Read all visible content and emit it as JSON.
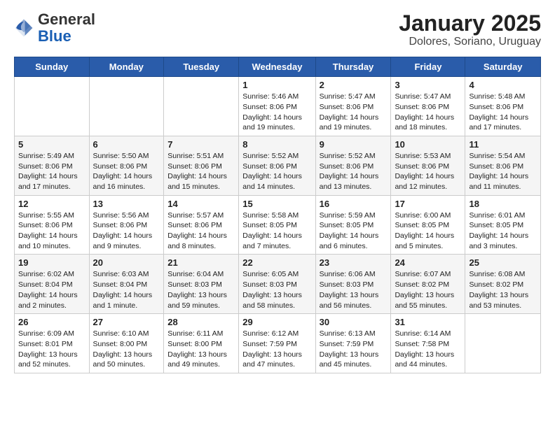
{
  "header": {
    "logo_general": "General",
    "logo_blue": "Blue",
    "title": "January 2025",
    "subtitle": "Dolores, Soriano, Uruguay"
  },
  "weekdays": [
    "Sunday",
    "Monday",
    "Tuesday",
    "Wednesday",
    "Thursday",
    "Friday",
    "Saturday"
  ],
  "weeks": [
    [
      {
        "day": "",
        "info": ""
      },
      {
        "day": "",
        "info": ""
      },
      {
        "day": "",
        "info": ""
      },
      {
        "day": "1",
        "info": "Sunrise: 5:46 AM\nSunset: 8:06 PM\nDaylight: 14 hours and 19 minutes."
      },
      {
        "day": "2",
        "info": "Sunrise: 5:47 AM\nSunset: 8:06 PM\nDaylight: 14 hours and 19 minutes."
      },
      {
        "day": "3",
        "info": "Sunrise: 5:47 AM\nSunset: 8:06 PM\nDaylight: 14 hours and 18 minutes."
      },
      {
        "day": "4",
        "info": "Sunrise: 5:48 AM\nSunset: 8:06 PM\nDaylight: 14 hours and 17 minutes."
      }
    ],
    [
      {
        "day": "5",
        "info": "Sunrise: 5:49 AM\nSunset: 8:06 PM\nDaylight: 14 hours and 17 minutes."
      },
      {
        "day": "6",
        "info": "Sunrise: 5:50 AM\nSunset: 8:06 PM\nDaylight: 14 hours and 16 minutes."
      },
      {
        "day": "7",
        "info": "Sunrise: 5:51 AM\nSunset: 8:06 PM\nDaylight: 14 hours and 15 minutes."
      },
      {
        "day": "8",
        "info": "Sunrise: 5:52 AM\nSunset: 8:06 PM\nDaylight: 14 hours and 14 minutes."
      },
      {
        "day": "9",
        "info": "Sunrise: 5:52 AM\nSunset: 8:06 PM\nDaylight: 14 hours and 13 minutes."
      },
      {
        "day": "10",
        "info": "Sunrise: 5:53 AM\nSunset: 8:06 PM\nDaylight: 14 hours and 12 minutes."
      },
      {
        "day": "11",
        "info": "Sunrise: 5:54 AM\nSunset: 8:06 PM\nDaylight: 14 hours and 11 minutes."
      }
    ],
    [
      {
        "day": "12",
        "info": "Sunrise: 5:55 AM\nSunset: 8:06 PM\nDaylight: 14 hours and 10 minutes."
      },
      {
        "day": "13",
        "info": "Sunrise: 5:56 AM\nSunset: 8:06 PM\nDaylight: 14 hours and 9 minutes."
      },
      {
        "day": "14",
        "info": "Sunrise: 5:57 AM\nSunset: 8:06 PM\nDaylight: 14 hours and 8 minutes."
      },
      {
        "day": "15",
        "info": "Sunrise: 5:58 AM\nSunset: 8:05 PM\nDaylight: 14 hours and 7 minutes."
      },
      {
        "day": "16",
        "info": "Sunrise: 5:59 AM\nSunset: 8:05 PM\nDaylight: 14 hours and 6 minutes."
      },
      {
        "day": "17",
        "info": "Sunrise: 6:00 AM\nSunset: 8:05 PM\nDaylight: 14 hours and 5 minutes."
      },
      {
        "day": "18",
        "info": "Sunrise: 6:01 AM\nSunset: 8:05 PM\nDaylight: 14 hours and 3 minutes."
      }
    ],
    [
      {
        "day": "19",
        "info": "Sunrise: 6:02 AM\nSunset: 8:04 PM\nDaylight: 14 hours and 2 minutes."
      },
      {
        "day": "20",
        "info": "Sunrise: 6:03 AM\nSunset: 8:04 PM\nDaylight: 14 hours and 1 minute."
      },
      {
        "day": "21",
        "info": "Sunrise: 6:04 AM\nSunset: 8:03 PM\nDaylight: 13 hours and 59 minutes."
      },
      {
        "day": "22",
        "info": "Sunrise: 6:05 AM\nSunset: 8:03 PM\nDaylight: 13 hours and 58 minutes."
      },
      {
        "day": "23",
        "info": "Sunrise: 6:06 AM\nSunset: 8:03 PM\nDaylight: 13 hours and 56 minutes."
      },
      {
        "day": "24",
        "info": "Sunrise: 6:07 AM\nSunset: 8:02 PM\nDaylight: 13 hours and 55 minutes."
      },
      {
        "day": "25",
        "info": "Sunrise: 6:08 AM\nSunset: 8:02 PM\nDaylight: 13 hours and 53 minutes."
      }
    ],
    [
      {
        "day": "26",
        "info": "Sunrise: 6:09 AM\nSunset: 8:01 PM\nDaylight: 13 hours and 52 minutes."
      },
      {
        "day": "27",
        "info": "Sunrise: 6:10 AM\nSunset: 8:00 PM\nDaylight: 13 hours and 50 minutes."
      },
      {
        "day": "28",
        "info": "Sunrise: 6:11 AM\nSunset: 8:00 PM\nDaylight: 13 hours and 49 minutes."
      },
      {
        "day": "29",
        "info": "Sunrise: 6:12 AM\nSunset: 7:59 PM\nDaylight: 13 hours and 47 minutes."
      },
      {
        "day": "30",
        "info": "Sunrise: 6:13 AM\nSunset: 7:59 PM\nDaylight: 13 hours and 45 minutes."
      },
      {
        "day": "31",
        "info": "Sunrise: 6:14 AM\nSunset: 7:58 PM\nDaylight: 13 hours and 44 minutes."
      },
      {
        "day": "",
        "info": ""
      }
    ]
  ]
}
